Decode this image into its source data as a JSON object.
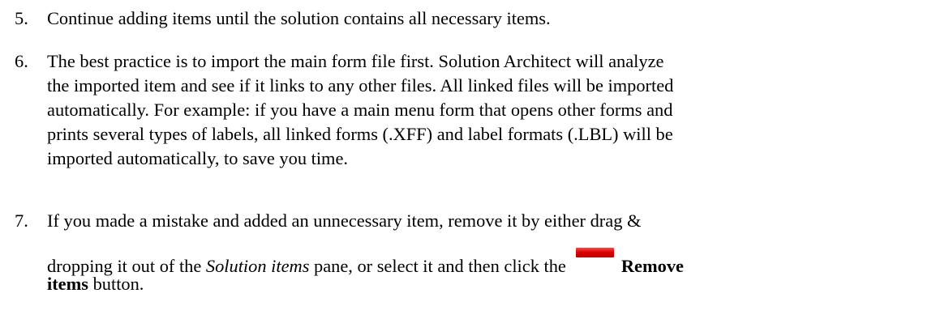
{
  "steps": [
    {
      "number": "5.",
      "lines": [
        "Continue adding items until the solution contains all necessary items."
      ]
    },
    {
      "number": "6.",
      "lines": [
        "The best practice is to import the main form file first. Solution Architect will analyze",
        "the imported item and see if it links to any other files. All linked files will be imported",
        "automatically. For example: if you have a main menu form that opens other forms and",
        "prints several types of labels, all linked forms (.XFF) and label formats (.LBL) will be",
        "imported automatically, to save you time."
      ]
    },
    {
      "number": "7.",
      "line1": "If you made a mistake and added an unnecessary item, remove it by either drag &",
      "line2_a": "dropping it out of the ",
      "line2_em": "Solution items",
      "line2_b": " pane, or select it and then click the",
      "button_bold_1": "Remove",
      "button_bold_2": "items",
      "line3_tail": " button.",
      "icon": "remove-items-icon",
      "icon_color": "#e00000"
    }
  ]
}
